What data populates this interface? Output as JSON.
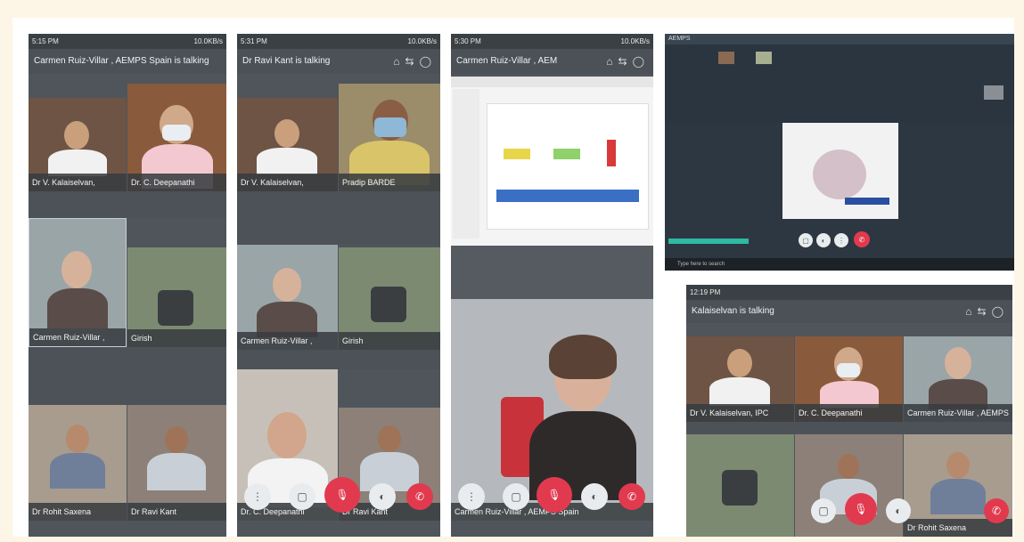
{
  "phone1": {
    "time": "5:15 PM",
    "net": "10.0KB/s",
    "header": "Carmen Ruiz-Villar , AEMPS Spain is talking",
    "tiles": [
      "Dr V. Kalaiselvan,",
      "Dr. C. Deepanathi",
      "Carmen Ruiz-Villar ,",
      "Girish",
      "Dr Rohit Saxena",
      "Dr Ravi Kant"
    ]
  },
  "phone2": {
    "time": "5:31 PM",
    "net": "10.0KB/s",
    "header": "Dr Ravi Kant is talking",
    "tiles": [
      "Dr V. Kalaiselvan,",
      "Pradip BARDE",
      "Carmen Ruiz-Villar ,",
      "Girish",
      "Dr. C. Deepanathi",
      "Dr Ravi Kant"
    ]
  },
  "phone3": {
    "time": "5:30 PM",
    "net": "10.0KB/s",
    "header": "Carmen Ruiz-Villar , AEM",
    "main_caption": "Carmen Ruiz-Villar , AEMPS Spain"
  },
  "desktop": {
    "title": "AEMPS",
    "search": "Type here to search"
  },
  "phone4": {
    "time": "12:19 PM",
    "header": "Kalaiselvan is talking",
    "tiles": [
      "Dr V. Kalaiselvan, IPC",
      "Dr. C. Deepanathi",
      "Carmen Ruiz-Villar , AEMPS",
      "",
      "",
      "Dr Rohit Saxena"
    ]
  }
}
